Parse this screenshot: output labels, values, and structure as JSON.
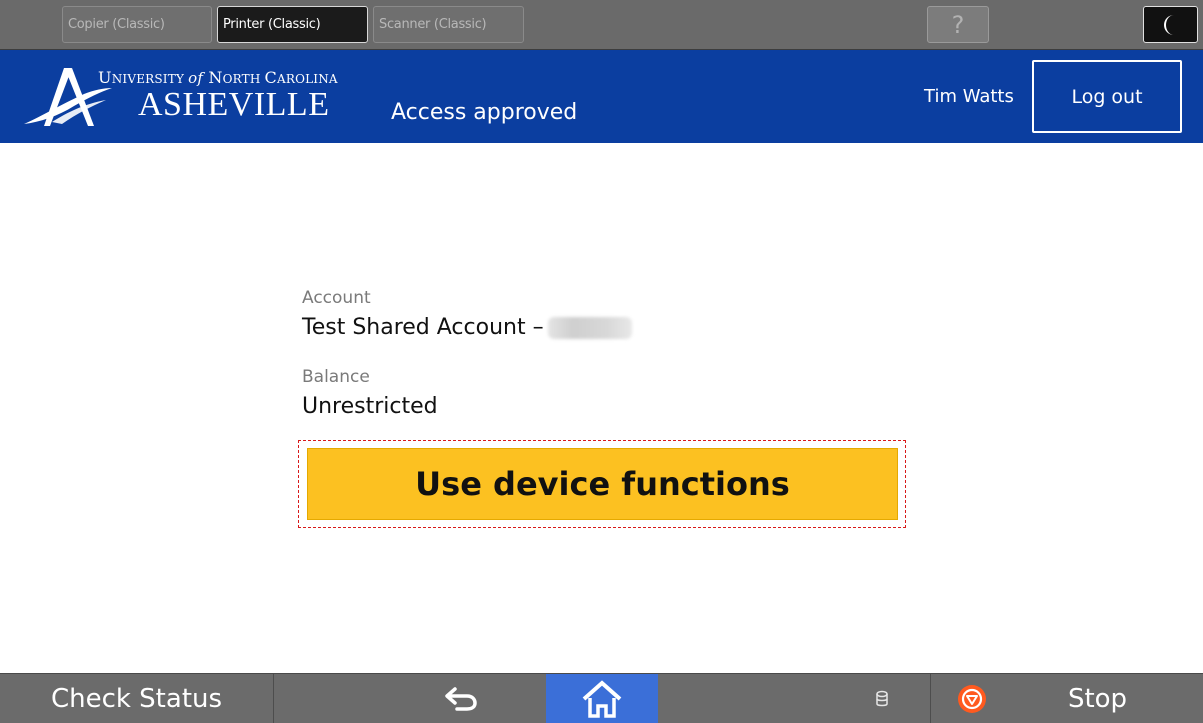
{
  "modebar": {
    "tabs": [
      {
        "label": "Copier (Classic)",
        "active": false
      },
      {
        "label": "Printer (Classic)",
        "active": true
      },
      {
        "label": "Scanner (Classic)",
        "active": false
      }
    ],
    "help_label": "?",
    "sleep_icon": "moon-icon"
  },
  "header": {
    "logo_line1": "University of North Carolina",
    "logo_line1_parts": {
      "a": "U",
      "b": "NIVERSITY ",
      "c": "of",
      "d": " N",
      "e": "ORTH ",
      "f": "C",
      "g": "AROLINA"
    },
    "logo_line2": "ASHEVILLE",
    "status": "Access approved",
    "user_name": "Tim Watts",
    "logout_label": "Log out",
    "background_color": "#0b3ea0"
  },
  "account": {
    "account_label": "Account",
    "account_value": "Test Shared Account –",
    "balance_label": "Balance",
    "balance_value": "Unrestricted"
  },
  "cta": {
    "label": "Use device functions",
    "color": "#fcc121"
  },
  "bottombar": {
    "check_status_label": "Check Status",
    "stop_label": "Stop",
    "home_highlight_color": "#3b6fd8",
    "icons": [
      "back-arrow-icon",
      "home-icon",
      "data-indicator-icon",
      "stop-icon"
    ]
  }
}
